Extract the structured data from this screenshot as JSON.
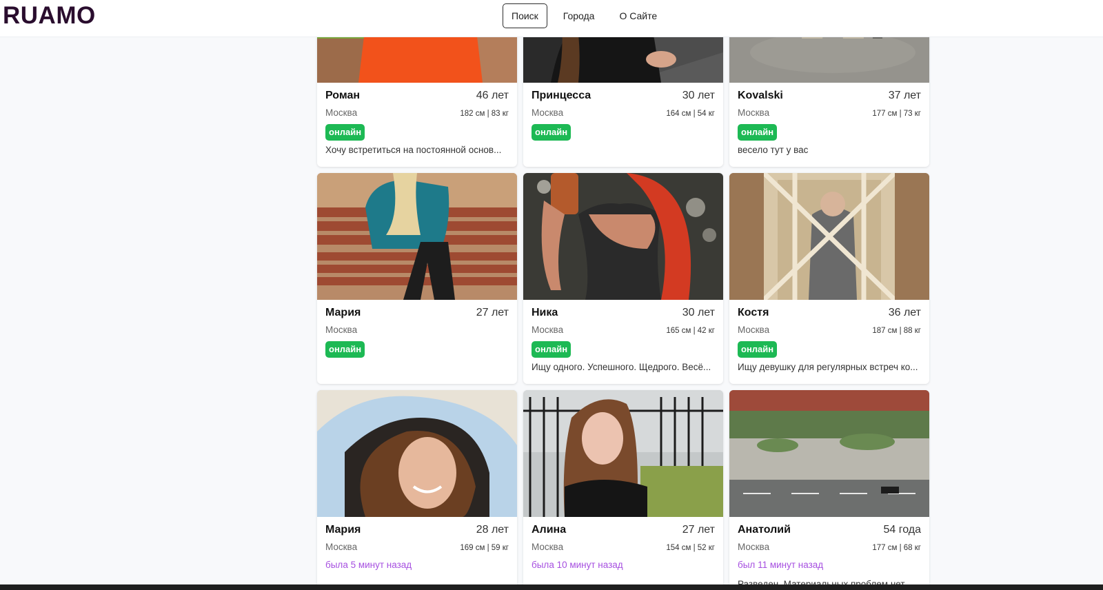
{
  "header": {
    "logo": "RUAMO",
    "nav": [
      {
        "label": "Поиск",
        "active": true
      },
      {
        "label": "Города",
        "active": false
      },
      {
        "label": "О Сайте",
        "active": false
      }
    ]
  },
  "profiles": [
    {
      "name": "Роман",
      "age": "46 лет",
      "city": "Москва",
      "params": "182 см | 83 кг",
      "online": true,
      "status_text": "онлайн",
      "about": "Хочу встретиться на постоянной основ...",
      "photo_icon": "man-orange-shirt-photo"
    },
    {
      "name": "Принцесса",
      "age": "30 лет",
      "city": "Москва",
      "params": "164 см | 54 кг",
      "online": true,
      "status_text": "онлайн",
      "about": "",
      "photo_icon": "woman-dark-outfit-photo"
    },
    {
      "name": "Kovalski",
      "age": "37 лет",
      "city": "Москва",
      "params": "177 см | 73 кг",
      "online": true,
      "status_text": "онлайн",
      "about": "весело тут у вас",
      "photo_icon": "man-beige-pants-photo"
    },
    {
      "name": "Мария",
      "age": "27 лет",
      "city": "Москва",
      "params": "",
      "online": true,
      "status_text": "онлайн",
      "about": "",
      "photo_icon": "woman-on-bench-photo"
    },
    {
      "name": "Ника",
      "age": "30 лет",
      "city": "Москва",
      "params": "165 см | 42 кг",
      "online": true,
      "status_text": "онлайн",
      "about": "Ищу одного. Успешного. Щедрого. Весё...",
      "photo_icon": "woman-red-hair-selfie-photo"
    },
    {
      "name": "Костя",
      "age": "36 лет",
      "city": "Москва",
      "params": "187 см | 88 кг",
      "online": true,
      "status_text": "онлайн",
      "about": "Ищу девушку для регулярных встреч ко...",
      "photo_icon": "man-mirror-selfie-photo"
    },
    {
      "name": "Мария",
      "age": "28 лет",
      "city": "Москва",
      "params": "169 см | 59 кг",
      "online": false,
      "status_text": "была 5 минут назад",
      "about": "",
      "photo_icon": "woman-curly-hair-photo"
    },
    {
      "name": "Алина",
      "age": "27 лет",
      "city": "Москва",
      "params": "154 см | 52 кг",
      "online": false,
      "status_text": "была 10 минут назад",
      "about": "",
      "photo_icon": "woman-black-lace-photo"
    },
    {
      "name": "Анатолий",
      "age": "54 года",
      "city": "Москва",
      "params": "177 см | 68 кг",
      "online": false,
      "status_text": "был 11 минут назад",
      "about": "Разведен. Материальных проблем нет...",
      "photo_icon": "city-square-view-photo"
    }
  ],
  "colors": {
    "online_badge": "#1db954",
    "last_seen": "#a64fe0",
    "logo": "#2a0d2e"
  }
}
